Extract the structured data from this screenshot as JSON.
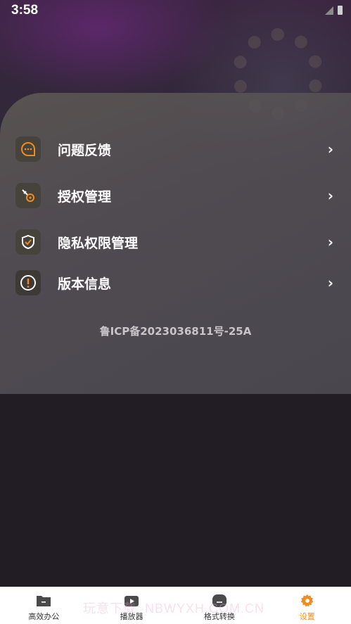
{
  "status_bar": {
    "time": "3:58"
  },
  "menu": {
    "items": [
      {
        "label": "问题反馈",
        "icon": "chat-bubble-icon"
      },
      {
        "label": "授权管理",
        "icon": "key-icon"
      },
      {
        "label": "隐私权限管理",
        "icon": "shield-check-icon"
      },
      {
        "label": "版本信息",
        "icon": "info-icon"
      }
    ],
    "chevron": "›"
  },
  "icp": "鲁ICP备2023036811号-25A",
  "bottom_nav": {
    "items": [
      {
        "label": "高效办公",
        "icon": "folder-icon",
        "active": false
      },
      {
        "label": "播放器",
        "icon": "play-icon",
        "active": false
      },
      {
        "label": "格式转换",
        "icon": "convert-icon",
        "active": false
      },
      {
        "label": "设置",
        "icon": "gear-icon",
        "active": true
      }
    ]
  },
  "watermark": "玩意下载: NBWYXH.COM.CN",
  "colors": {
    "accent": "#f08c1e",
    "panel": "#5a5552",
    "bottom_bg": "#221d24"
  }
}
